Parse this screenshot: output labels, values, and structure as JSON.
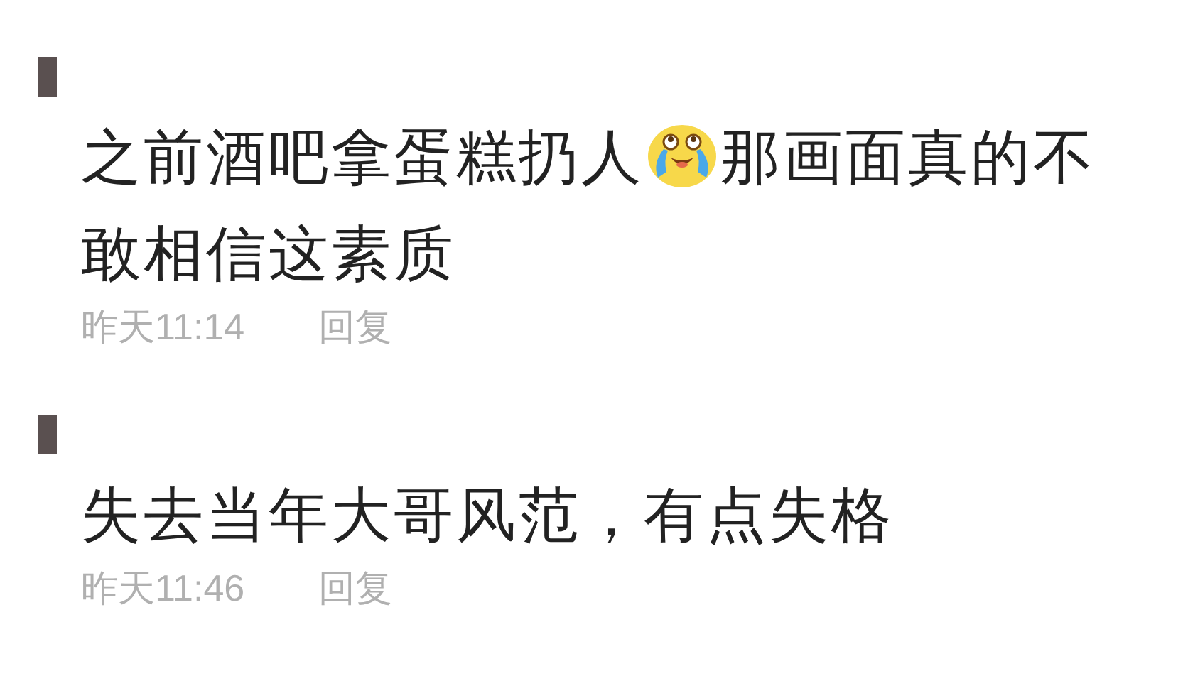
{
  "comments": [
    {
      "lines": [
        [
          {
            "kind": "text",
            "text": "之前酒吧拿蛋糕扔人"
          },
          {
            "kind": "emoji"
          },
          {
            "kind": "text",
            "text": "那画面真的不"
          }
        ],
        [
          {
            "kind": "text",
            "text": "敢相信这素质"
          }
        ]
      ],
      "time": "昨天11:14",
      "reply": "回复"
    },
    {
      "lines": [
        [
          {
            "kind": "text",
            "text": "失去当年大哥风范，有点失格"
          }
        ]
      ],
      "time": "昨天11:46",
      "reply": "回复"
    }
  ]
}
